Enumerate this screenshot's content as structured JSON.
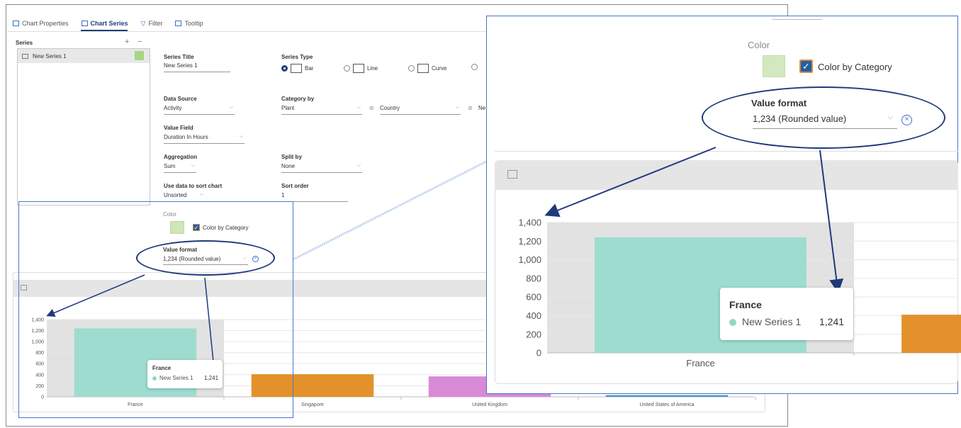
{
  "tabs": [
    {
      "label": "Chart Properties"
    },
    {
      "label": "Chart Series"
    },
    {
      "label": "Filter"
    },
    {
      "label": "Tooltip"
    }
  ],
  "series_panel": {
    "heading": "Series",
    "add_symbol": "+",
    "remove_symbol": "−",
    "items": [
      {
        "label": "New Series 1",
        "color": "#a7d584"
      }
    ]
  },
  "form": {
    "series_title_label": "Series Title",
    "series_title_value": "New Series 1",
    "series_type_label": "Series Type",
    "series_types": [
      "Bar",
      "Line",
      "Curve"
    ],
    "data_source_label": "Data Source",
    "data_source_value": "Activity",
    "category_by_label": "Category by",
    "category_by_value": "Plant",
    "category_by_value2": "Country",
    "category_by_value3": "Ne",
    "value_field_label": "Value Field",
    "value_field_value": "Duration In Hours",
    "aggregation_label": "Aggregation",
    "aggregation_value": "Sum",
    "split_by_label": "Split by",
    "split_by_value": "None",
    "sort_label": "Use data to sort chart",
    "sort_value": "Unsorted",
    "sort_order_label": "Sort order",
    "sort_order_value": "1"
  },
  "color_section": {
    "color_label": "Color",
    "color_by_category_label": "Color by Category",
    "color_by_category_checked": true,
    "swatch_color": "#cfe6b8",
    "value_format_label": "Value format",
    "value_format_value": "1,234 (Rounded value)"
  },
  "tooltip": {
    "title": "France",
    "series": "New Series 1",
    "value": "1,241"
  },
  "chart_data": [
    {
      "type": "bar",
      "categories": [
        "France",
        "Singapore",
        "United Kingdom",
        "United States of America"
      ],
      "values": [
        1241,
        410,
        370,
        30
      ],
      "colors": [
        "#9edcd0",
        "#e3922b",
        "#d88ad6",
        "#4a8fd8"
      ],
      "ylim": [
        0,
        1400
      ],
      "yticks": [
        0,
        200,
        400,
        600,
        800,
        1000,
        1200,
        1400
      ]
    },
    {
      "type": "bar",
      "categories": [
        "France",
        "Singapore"
      ],
      "values": [
        1241,
        410
      ],
      "colors": [
        "#9edcd0",
        "#e3922b"
      ],
      "ylim": [
        0,
        1400
      ],
      "yticks": [
        0,
        200,
        400,
        600,
        800,
        1000,
        1200,
        1400
      ]
    }
  ]
}
